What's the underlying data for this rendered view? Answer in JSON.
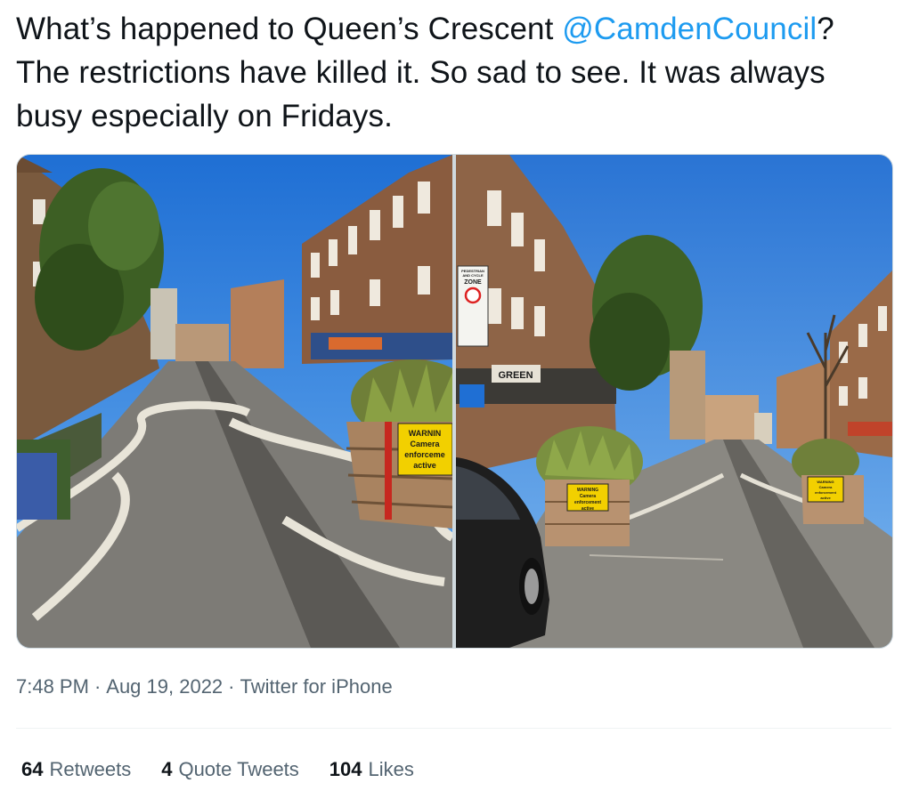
{
  "tweet": {
    "text_before": "What’s happened to Queen’s Crescent ",
    "mention": "@CamdenCouncil",
    "text_after": "? The restrictions have killed it. So sad to see. It was always busy especially on Fridays."
  },
  "media": {
    "left_photo": {
      "sign_lines": [
        "WARNIN",
        "Camera",
        "enforceme",
        "active"
      ]
    },
    "right_photo": {
      "pole_sign_lines": [
        "PEDESTRIAN",
        "AND CYCLE",
        "ZONE"
      ],
      "planter_sign_lines": [
        "WARNING",
        "Camera",
        "enforcement",
        "active"
      ],
      "shop_sign": "GREEN"
    }
  },
  "meta": {
    "time": "7:48 PM",
    "date": "Aug 19, 2022",
    "source": "Twitter for iPhone",
    "separator": "·"
  },
  "stats": {
    "retweets_count": "64",
    "retweets_label": "Retweets",
    "quotes_count": "4",
    "quotes_label": "Quote Tweets",
    "likes_count": "104",
    "likes_label": "Likes"
  },
  "colors": {
    "link": "#1d9bf0",
    "text_primary": "#0f1419",
    "text_secondary": "#536471",
    "divider": "#eff3f4"
  }
}
